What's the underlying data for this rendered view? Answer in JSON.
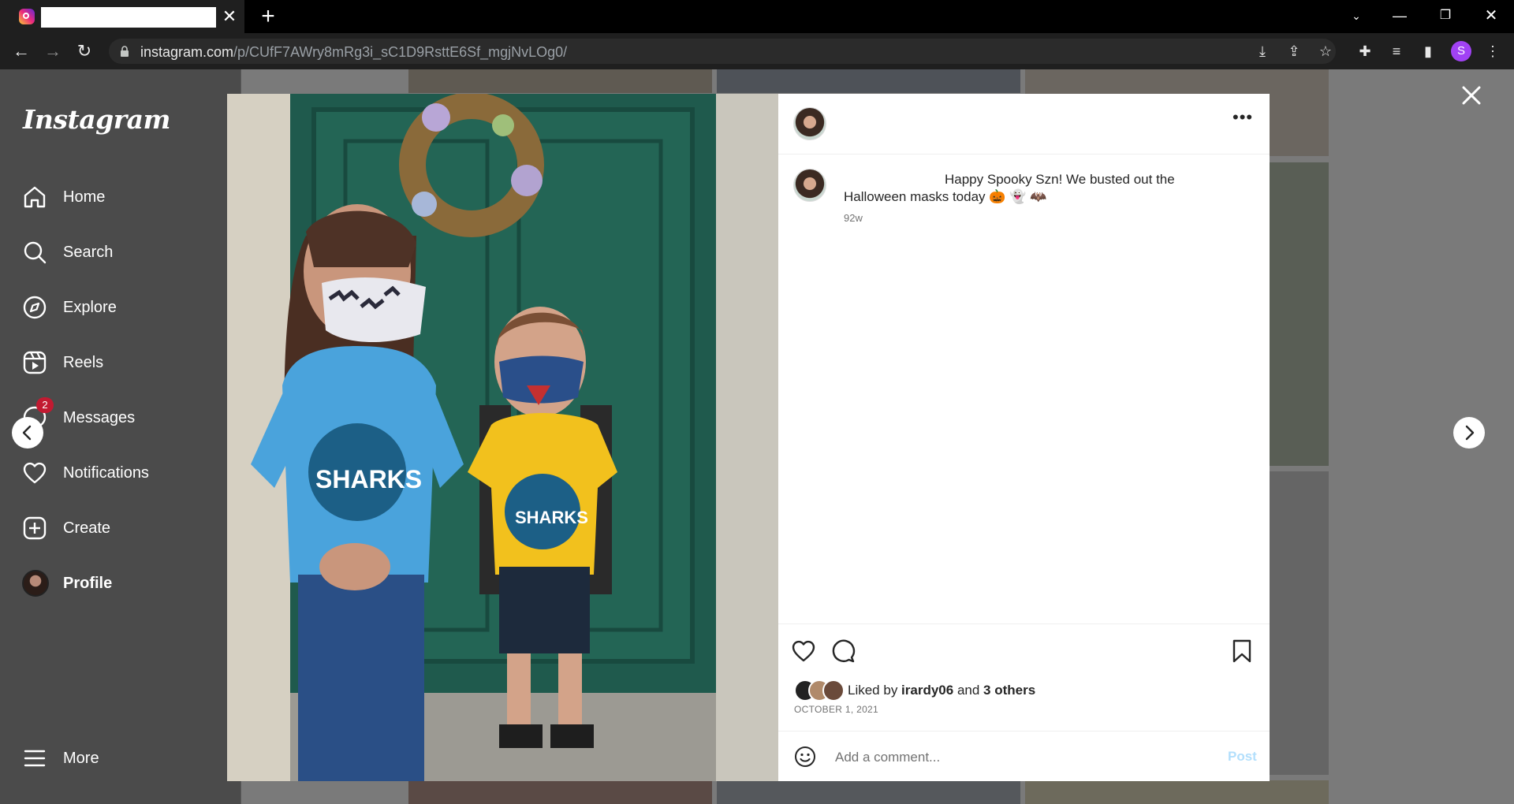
{
  "browser": {
    "tab_close": "✕",
    "new_tab": "+",
    "url_host": "instagram.com",
    "url_path": "/p/CUfF7AWry8mRg3i_sC1D9RsttE6Sf_mgjNvLOg0/",
    "profile_initial": "S"
  },
  "sidebar": {
    "logo": "Instagram",
    "items": [
      {
        "label": "Home",
        "icon": "home-icon"
      },
      {
        "label": "Search",
        "icon": "search-icon"
      },
      {
        "label": "Explore",
        "icon": "compass-icon"
      },
      {
        "label": "Reels",
        "icon": "reels-icon"
      },
      {
        "label": "Messages",
        "icon": "messenger-icon",
        "badge": "2"
      },
      {
        "label": "Notifications",
        "icon": "heart-icon"
      },
      {
        "label": "Create",
        "icon": "plus-square-icon"
      },
      {
        "label": "Profile",
        "icon": "avatar"
      },
      {
        "label": "More",
        "icon": "menu-icon"
      }
    ]
  },
  "post": {
    "caption": "Happy Spooky Szn! We busted out the Halloween masks today 🎃 👻 🦇",
    "time_ago": "92w",
    "liked_prefix": "Liked by ",
    "liked_user": "irardy06",
    "liked_mid": " and ",
    "liked_others": "3 others",
    "date": "OCTOBER 1, 2021",
    "comment_placeholder": "Add a comment...",
    "post_button": "Post",
    "more_options": "•••"
  },
  "colors": {
    "link_button": "#b2dffc",
    "badge": "#c21a31",
    "backdrop": "#7a7a7a"
  }
}
